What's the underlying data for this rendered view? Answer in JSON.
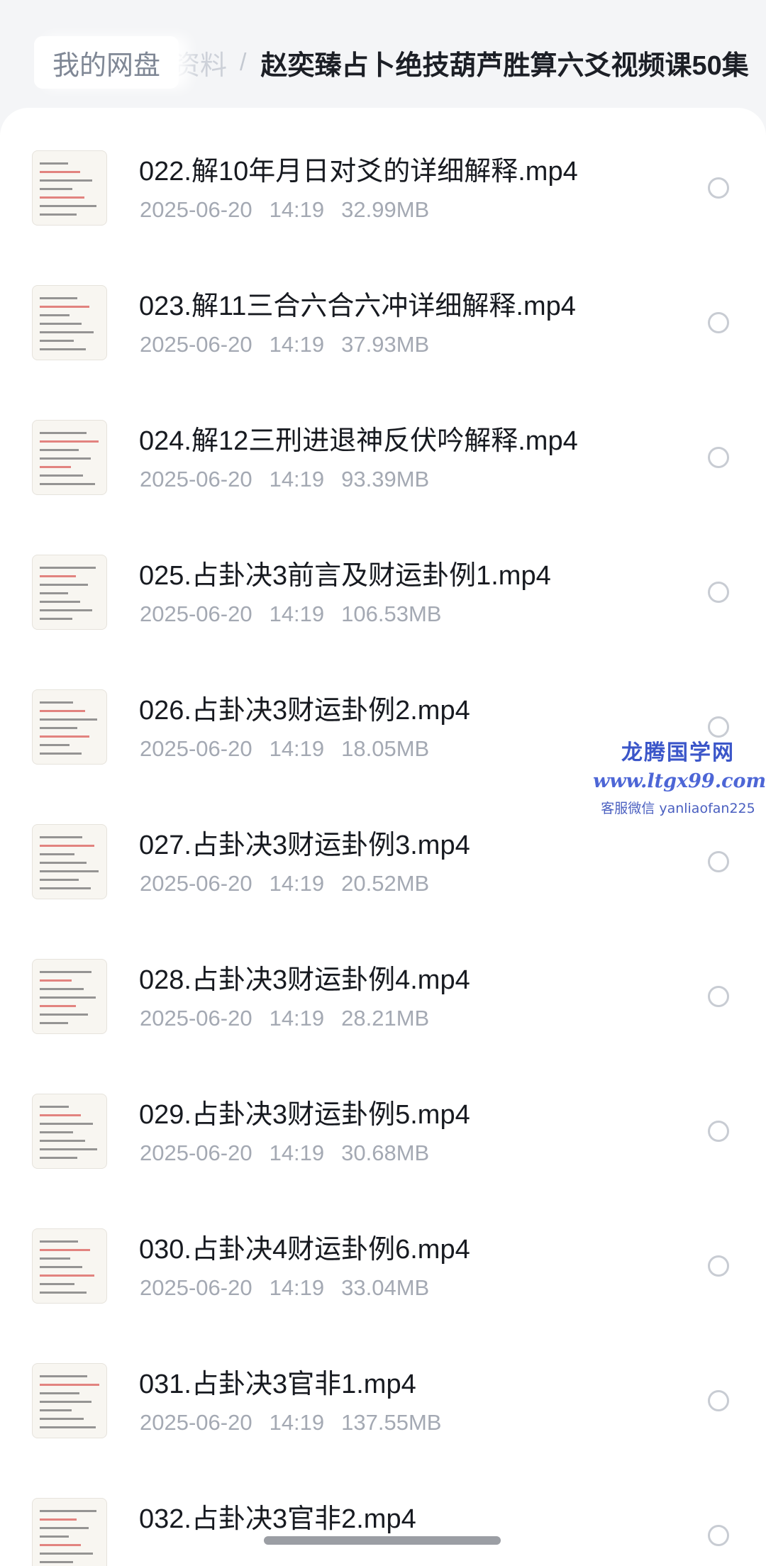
{
  "breadcrumb": {
    "root": "我的网盘",
    "middle": "资料",
    "separator": "/",
    "current": "赵奕臻占卜绝技葫芦胜算六爻视频课50集"
  },
  "files": [
    {
      "name": "022.解10年月日对爻的详细解释.mp4",
      "date": "2025-06-20",
      "time": "14:19",
      "size": "32.99MB",
      "thumb_icon": "document-thumbnail-icon"
    },
    {
      "name": "023.解11三合六合六冲详细解释.mp4",
      "date": "2025-06-20",
      "time": "14:19",
      "size": "37.93MB",
      "thumb_icon": "document-thumbnail-icon"
    },
    {
      "name": "024.解12三刑进退神反伏吟解释.mp4",
      "date": "2025-06-20",
      "time": "14:19",
      "size": "93.39MB",
      "thumb_icon": "document-thumbnail-icon"
    },
    {
      "name": "025.占卦决3前言及财运卦例1.mp4",
      "date": "2025-06-20",
      "time": "14:19",
      "size": "106.53MB",
      "thumb_icon": "document-thumbnail-icon"
    },
    {
      "name": "026.占卦决3财运卦例2.mp4",
      "date": "2025-06-20",
      "time": "14:19",
      "size": "18.05MB",
      "thumb_icon": "document-thumbnail-icon"
    },
    {
      "name": "027.占卦决3财运卦例3.mp4",
      "date": "2025-06-20",
      "time": "14:19",
      "size": "20.52MB",
      "thumb_icon": "document-thumbnail-icon"
    },
    {
      "name": "028.占卦决3财运卦例4.mp4",
      "date": "2025-06-20",
      "time": "14:19",
      "size": "28.21MB",
      "thumb_icon": "document-thumbnail-icon"
    },
    {
      "name": "029.占卦决3财运卦例5.mp4",
      "date": "2025-06-20",
      "time": "14:19",
      "size": "30.68MB",
      "thumb_icon": "document-thumbnail-icon"
    },
    {
      "name": "030.占卦决4财运卦例6.mp4",
      "date": "2025-06-20",
      "time": "14:19",
      "size": "33.04MB",
      "thumb_icon": "document-thumbnail-icon"
    },
    {
      "name": "031.占卦决3官非1.mp4",
      "date": "2025-06-20",
      "time": "14:19",
      "size": "137.55MB",
      "thumb_icon": "document-thumbnail-icon"
    },
    {
      "name": "032.占卦决3官非2.mp4",
      "date": "",
      "time": "",
      "size": "",
      "thumb_icon": "document-thumbnail-icon"
    }
  ],
  "watermark": {
    "title": "龙腾国学网",
    "url": "www.ltgx99.com",
    "contact": "客服微信 yanliaofan225"
  },
  "colors": {
    "background": "#f4f5f7",
    "card": "#ffffff",
    "primary_text": "#171a20",
    "secondary_text": "#a4a9b3",
    "watermark": "#3b56c9"
  }
}
